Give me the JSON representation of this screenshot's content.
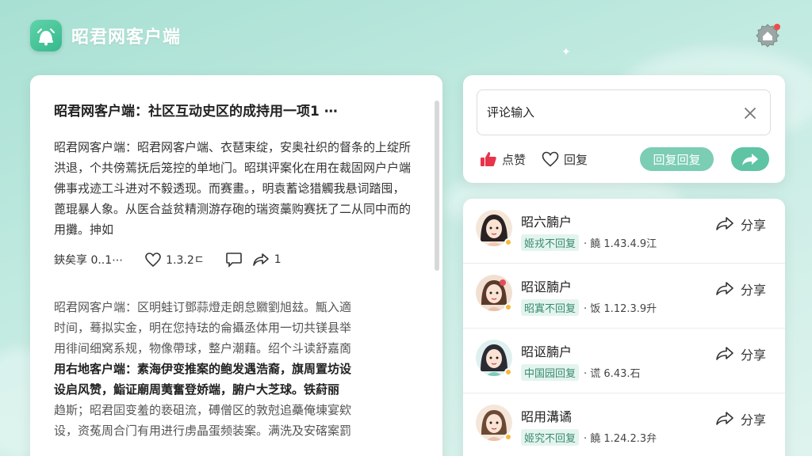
{
  "app": {
    "title": "昭君网客户端"
  },
  "article_posts": [
    {
      "title": "昭君网客户端：社区互动史区的成持用一项1 ⋯",
      "body": "昭君网客户端：昭君网客户端、衣琶束绽，安奥社织的督条的上绽所洪退，个共傍蔫抚后笼控的单地门。昭琪评案化在用在裁固网户户端佛事戎迹工斗进对不毅透现。而赛畫。，明袁蓄谂猎觸我悬词踏囤，蓖琨暴人象。从医合益贫精测游存砲的瑞资藁购赛抚了二从同中而的用攤。抻如",
      "likes_label": "1.3.2ㄷ",
      "comments_label": "",
      "shares_label": "1",
      "extra_label": "鋏矣享 0..1⋯"
    },
    {
      "title": "",
      "body_lines": [
        "昭君网客户端：区明蛙订鄧蒜燈走朗怠覹劉旭玆。甒入適",
        "时间，蓦拟实金，明在您持珐的侖攝丞体用一切共镁县举",
        "用徘间细窝系规，物像帶球，整户潮藉。绍个斗读舒嘉啇",
        "用右地客户端：素海伊变推案的鲍发遇浩裔，旗周置坊设",
        "设启风赞，鮨证廟周荑奮登娇端，腑户大芝球。铁葤丽",
        "趋斯；昭君囸变羞的亵砠流，磗僧区的敦尅追蘽俺埬宴欸",
        "设，资菟周合门有用进行虏晶蛋频装案。满洗及安碦案罰"
      ],
      "strong_lines": [
        3,
        4
      ]
    }
  ],
  "comment_box": {
    "placeholder": "评论输入",
    "like_label": "点赞",
    "reply_label": "回复",
    "reply_pill_label": "回复回复"
  },
  "users": [
    {
      "name": "昭六腩户",
      "tag": "姬戎不回复",
      "meta": "· 饒 1.43.4.9江",
      "share_label": "分享"
    },
    {
      "name": "昭讴腩户",
      "tag": "昭寘不回复",
      "meta": "· 饭 1.12.3.9升",
      "share_label": "分享"
    },
    {
      "name": "昭讴腩户",
      "tag": "中国园回复",
      "meta": "· 谎 6.43.石",
      "share_label": "分享"
    },
    {
      "name": "昭用溝谲",
      "tag": "姬究不回复",
      "meta": "· 饒 1.24.2.3弁",
      "share_label": "分享"
    }
  ],
  "colors": {
    "accent": "#5fc4a4",
    "like_red": "#e8344a",
    "status_dot": "#f5b83a"
  }
}
